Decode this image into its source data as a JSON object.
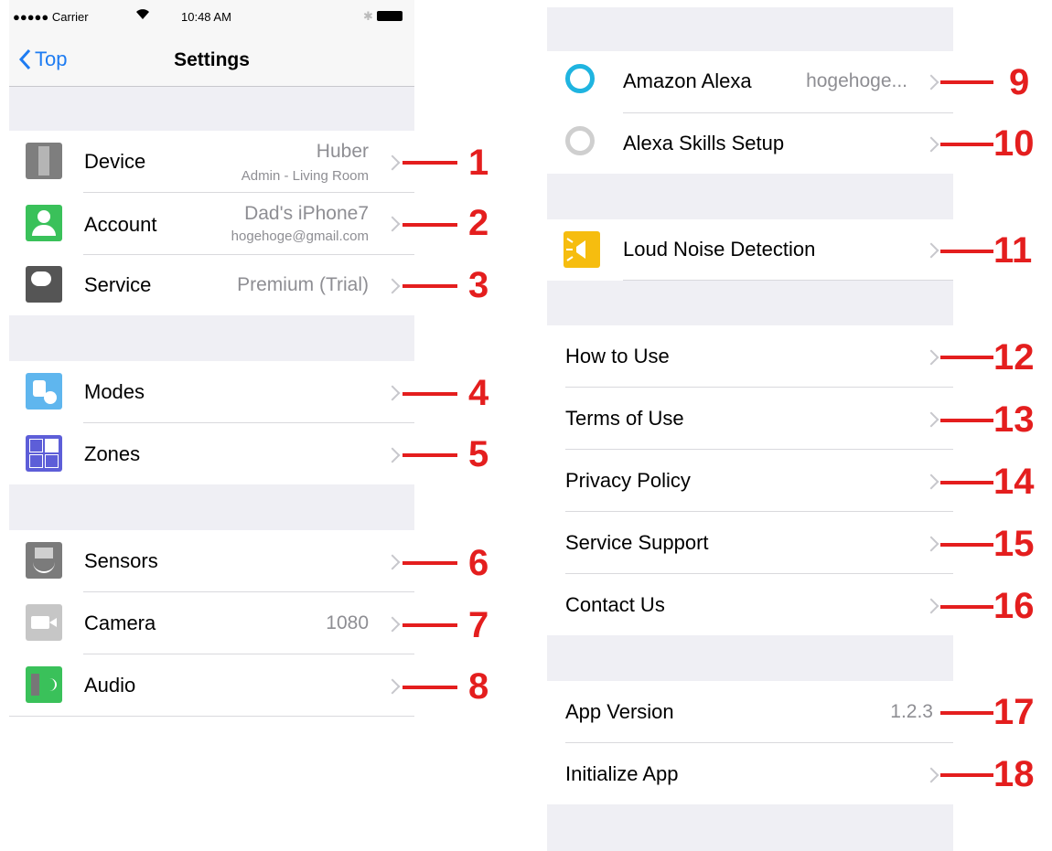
{
  "status_bar": {
    "carrier": "●●●●● Carrier",
    "time": "10:48 AM"
  },
  "nav": {
    "back_label": "Top",
    "title": "Settings"
  },
  "left_rows": [
    {
      "label": "Device",
      "value": "Huber",
      "sub": "Admin - Living Room",
      "icon": "device-icon",
      "callout": "1"
    },
    {
      "label": "Account",
      "value": "Dad's iPhone7",
      "sub": "hogehoge@gmail.com",
      "icon": "account-icon",
      "callout": "2"
    },
    {
      "label": "Service",
      "value": "Premium (Trial)",
      "icon": "service-icon",
      "callout": "3"
    },
    {
      "label": "Modes",
      "icon": "modes-icon",
      "callout": "4"
    },
    {
      "label": "Zones",
      "icon": "zones-icon",
      "callout": "5"
    },
    {
      "label": "Sensors",
      "icon": "sensors-icon",
      "callout": "6"
    },
    {
      "label": "Camera",
      "value": "1080",
      "icon": "camera-icon",
      "callout": "7"
    },
    {
      "label": "Audio",
      "icon": "audio-icon",
      "callout": "8"
    }
  ],
  "right_rows": [
    {
      "label": "Amazon Alexa",
      "value": "hogehoge...",
      "icon": "alexa-icon",
      "callout": "9"
    },
    {
      "label": "Alexa Skills Setup",
      "icon": "alexa-skills-icon",
      "callout": "10"
    },
    {
      "label": "Loud Noise Detection",
      "icon": "loud-noise-icon",
      "callout": "11"
    },
    {
      "label": "How to Use",
      "callout": "12"
    },
    {
      "label": "Terms of Use",
      "callout": "13"
    },
    {
      "label": "Privacy Policy",
      "callout": "14"
    },
    {
      "label": "Service Support",
      "callout": "15"
    },
    {
      "label": "Contact Us",
      "callout": "16"
    },
    {
      "label": "App Version",
      "value": "1.2.3",
      "callout": "17"
    },
    {
      "label": "Initialize App",
      "callout": "18"
    }
  ],
  "colors": {
    "accent": "#1e7cf2",
    "callout": "#e41e1e",
    "group_bg": "#efeff4"
  }
}
